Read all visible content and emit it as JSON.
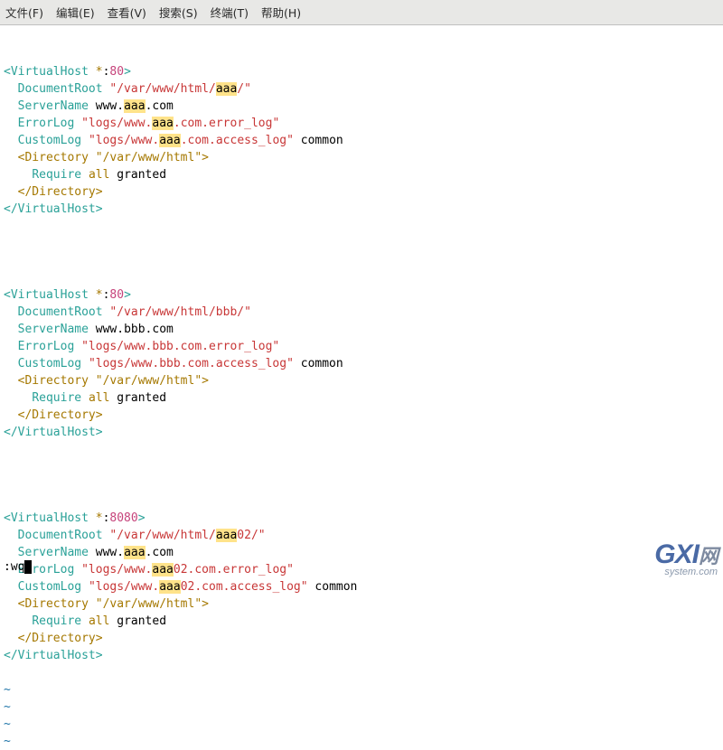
{
  "menubar": {
    "file": "文件(F)",
    "edit": "编辑(E)",
    "view": "查看(V)",
    "search": "搜索(S)",
    "term": "终端(T)",
    "help": "帮助(H)"
  },
  "vhosts": [
    {
      "port": "80",
      "docroot_prefix": "\"/var/www/html/",
      "docroot_hl": "aaa",
      "docroot_suffix": "/\"",
      "servername_prefix": "www.",
      "servername_hl": "aaa",
      "servername_suffix": ".com",
      "errorlog_prefix": "\"logs/www.",
      "errorlog_hl": "aaa",
      "errorlog_suffix": ".com.error_log\"",
      "customlog_prefix": "\"logs/www.",
      "customlog_hl": "aaa",
      "customlog_suffix": ".com.access_log\"",
      "customlog_arg": "common",
      "dir_open": "<Directory \"/var/www/html\">",
      "require": "Require",
      "require_arg1": "all",
      "require_arg2": "granted",
      "dir_close": "</Directory>"
    },
    {
      "port": "80",
      "docroot": "\"/var/www/html/bbb/\"",
      "servername": "www.bbb.com",
      "errorlog": "\"logs/www.bbb.com.error_log\"",
      "customlog": "\"logs/www.bbb.com.access_log\"",
      "customlog_arg": "common",
      "dir_open": "<Directory \"/var/www/html\">",
      "require": "Require",
      "require_arg1": "all",
      "require_arg2": "granted",
      "dir_close": "</Directory>"
    },
    {
      "port": "8080",
      "docroot_prefix": "\"/var/www/html/",
      "docroot_hl": "aaa",
      "docroot_suffix": "02/\"",
      "servername_prefix": "www.",
      "servername_hl": "aaa",
      "servername_suffix": ".com",
      "errorlog_prefix": "\"logs/www.",
      "errorlog_hl": "aaa",
      "errorlog_suffix": "02.com.error_log\"",
      "customlog_prefix": "\"logs/www.",
      "customlog_hl": "aaa",
      "customlog_suffix": "02.com.access_log\"",
      "customlog_arg": "common",
      "dir_open": "<Directory \"/var/www/html\">",
      "require": "Require",
      "require_arg1": "all",
      "require_arg2": "granted",
      "dir_close": "</Directory>"
    }
  ],
  "tokens": {
    "vh_open_l": "<",
    "vh_open_name": "VirtualHost",
    "vh_open_star": " *",
    "vh_open_colon": ":",
    "vh_open_r": ">",
    "vh_close": "</VirtualHost>",
    "DocumentRoot": "DocumentRoot",
    "ServerName": "ServerName",
    "ErrorLog": "ErrorLog",
    "CustomLog": "CustomLog"
  },
  "cmdline": ":wq",
  "tilde": "~",
  "watermark": {
    "brand": "GXI",
    "suffix": "网",
    "domain": "system.com"
  }
}
